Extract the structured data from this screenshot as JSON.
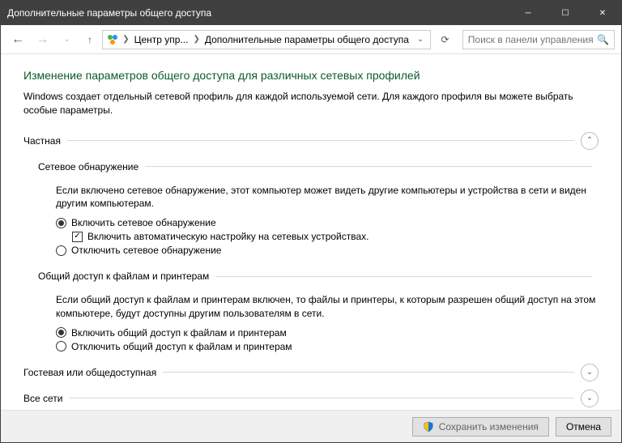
{
  "window": {
    "title": "Дополнительные параметры общего доступа"
  },
  "nav": {
    "breadcrumb1": "Центр упр...",
    "breadcrumb2": "Дополнительные параметры общего доступа",
    "search_placeholder": "Поиск в панели управления"
  },
  "main": {
    "heading": "Изменение параметров общего доступа для различных сетевых профилей",
    "description": "Windows создает отдельный сетевой профиль для каждой используемой сети. Для каждого профиля вы можете выбрать особые параметры."
  },
  "private": {
    "title": "Частная",
    "discovery": {
      "title": "Сетевое обнаружение",
      "desc": "Если включено сетевое обнаружение, этот компьютер может видеть другие компьютеры и устройства в сети и виден другим компьютерам.",
      "opt_on": "Включить сетевое обнаружение",
      "auto": "Включить автоматическую настройку на сетевых устройствах.",
      "opt_off": "Отключить сетевое обнаружение"
    },
    "fileshare": {
      "title": "Общий доступ к файлам и принтерам",
      "desc": "Если общий доступ к файлам и принтерам включен, то файлы и принтеры, к которым разрешен общий доступ на этом компьютере, будут доступны другим пользователям в сети.",
      "opt_on": "Включить общий доступ к файлам и принтерам",
      "opt_off": "Отключить общий доступ к файлам и принтерам"
    }
  },
  "guest": {
    "title": "Гостевая или общедоступная"
  },
  "all": {
    "title": "Все сети"
  },
  "footer": {
    "save": "Сохранить изменения",
    "cancel": "Отмена"
  }
}
